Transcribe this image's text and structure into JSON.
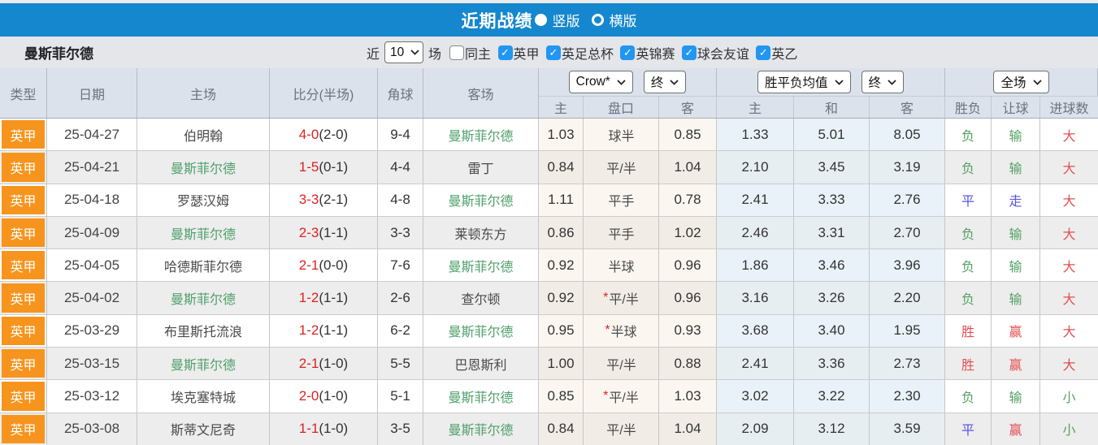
{
  "titlebar": {
    "title": "近期战绩",
    "radios": [
      {
        "label": "竖版",
        "selected": true
      },
      {
        "label": "横版",
        "selected": false
      }
    ]
  },
  "filterbar": {
    "team": "曼斯菲尔德",
    "recent_label": "近",
    "recent_value": "10",
    "matches_label": "场",
    "checkboxes": [
      {
        "label": "同主",
        "checked": false
      },
      {
        "label": "英甲",
        "checked": true
      },
      {
        "label": "英足总杯",
        "checked": true
      },
      {
        "label": "英锦赛",
        "checked": true
      },
      {
        "label": "球会友谊",
        "checked": true
      },
      {
        "label": "英乙",
        "checked": true
      }
    ]
  },
  "table": {
    "static_headers": [
      "类型",
      "日期",
      "主场",
      "比分(半场)",
      "角球",
      "客场"
    ],
    "groups": [
      {
        "selects": [
          "Crow*",
          "终"
        ],
        "cols": [
          "主",
          "盘口",
          "客"
        ]
      },
      {
        "selects": [
          "胜平负均值",
          "终"
        ],
        "cols": [
          "主",
          "和",
          "客"
        ]
      },
      {
        "selects": [
          "全场"
        ],
        "cols": [
          "胜负",
          "让球",
          "进球数"
        ]
      }
    ],
    "rows": [
      {
        "league": "英甲",
        "date": "25-04-27",
        "home": "伯明翰",
        "home_hl": false,
        "score": "4-0",
        "half": "(2-0)",
        "corners": "9-4",
        "away": "曼斯菲尔德",
        "away_hl": true,
        "o_home": "1.03",
        "hcap": "球半",
        "star": false,
        "o_away": "0.85",
        "a_home": "1.33",
        "a_draw": "5.01",
        "a_away": "8.05",
        "res": [
          {
            "t": "负",
            "c": "green"
          },
          {
            "t": "输",
            "c": "green"
          },
          {
            "t": "大",
            "c": "red"
          }
        ]
      },
      {
        "league": "英甲",
        "date": "25-04-21",
        "home": "曼斯菲尔德",
        "home_hl": true,
        "score": "1-5",
        "half": "(0-1)",
        "corners": "4-4",
        "away": "雷丁",
        "away_hl": false,
        "o_home": "0.84",
        "hcap": "平/半",
        "star": false,
        "o_away": "1.04",
        "a_home": "2.10",
        "a_draw": "3.45",
        "a_away": "3.19",
        "res": [
          {
            "t": "负",
            "c": "green"
          },
          {
            "t": "输",
            "c": "green"
          },
          {
            "t": "大",
            "c": "red"
          }
        ]
      },
      {
        "league": "英甲",
        "date": "25-04-18",
        "home": "罗瑟汉姆",
        "home_hl": false,
        "score": "3-3",
        "half": "(2-1)",
        "corners": "4-8",
        "away": "曼斯菲尔德",
        "away_hl": true,
        "o_home": "1.11",
        "hcap": "平手",
        "star": false,
        "o_away": "0.78",
        "a_home": "2.41",
        "a_draw": "3.33",
        "a_away": "2.76",
        "res": [
          {
            "t": "平",
            "c": "blue"
          },
          {
            "t": "走",
            "c": "blue"
          },
          {
            "t": "大",
            "c": "red"
          }
        ]
      },
      {
        "league": "英甲",
        "date": "25-04-09",
        "home": "曼斯菲尔德",
        "home_hl": true,
        "score": "2-3",
        "half": "(1-1)",
        "corners": "3-3",
        "away": "莱顿东方",
        "away_hl": false,
        "o_home": "0.86",
        "hcap": "平手",
        "star": false,
        "o_away": "1.02",
        "a_home": "2.46",
        "a_draw": "3.31",
        "a_away": "2.70",
        "res": [
          {
            "t": "负",
            "c": "green"
          },
          {
            "t": "输",
            "c": "green"
          },
          {
            "t": "大",
            "c": "red"
          }
        ]
      },
      {
        "league": "英甲",
        "date": "25-04-05",
        "home": "哈德斯菲尔德",
        "home_hl": false,
        "score": "2-1",
        "half": "(0-0)",
        "corners": "7-6",
        "away": "曼斯菲尔德",
        "away_hl": true,
        "o_home": "0.92",
        "hcap": "半球",
        "star": false,
        "o_away": "0.96",
        "a_home": "1.86",
        "a_draw": "3.46",
        "a_away": "3.96",
        "res": [
          {
            "t": "负",
            "c": "green"
          },
          {
            "t": "输",
            "c": "green"
          },
          {
            "t": "大",
            "c": "red"
          }
        ]
      },
      {
        "league": "英甲",
        "date": "25-04-02",
        "home": "曼斯菲尔德",
        "home_hl": true,
        "score": "1-2",
        "half": "(1-1)",
        "corners": "2-6",
        "away": "查尔顿",
        "away_hl": false,
        "o_home": "0.92",
        "hcap": "平/半",
        "star": true,
        "o_away": "0.96",
        "a_home": "3.16",
        "a_draw": "3.26",
        "a_away": "2.20",
        "res": [
          {
            "t": "负",
            "c": "green"
          },
          {
            "t": "输",
            "c": "green"
          },
          {
            "t": "大",
            "c": "red"
          }
        ]
      },
      {
        "league": "英甲",
        "date": "25-03-29",
        "home": "布里斯托流浪",
        "home_hl": false,
        "score": "1-2",
        "half": "(1-1)",
        "corners": "6-2",
        "away": "曼斯菲尔德",
        "away_hl": true,
        "o_home": "0.95",
        "hcap": "半球",
        "star": true,
        "o_away": "0.93",
        "a_home": "3.68",
        "a_draw": "3.40",
        "a_away": "1.95",
        "res": [
          {
            "t": "胜",
            "c": "red"
          },
          {
            "t": "赢",
            "c": "red"
          },
          {
            "t": "大",
            "c": "red"
          }
        ]
      },
      {
        "league": "英甲",
        "date": "25-03-15",
        "home": "曼斯菲尔德",
        "home_hl": true,
        "score": "2-1",
        "half": "(1-0)",
        "corners": "5-5",
        "away": "巴恩斯利",
        "away_hl": false,
        "o_home": "1.00",
        "hcap": "平/半",
        "star": false,
        "o_away": "0.88",
        "a_home": "2.41",
        "a_draw": "3.36",
        "a_away": "2.73",
        "res": [
          {
            "t": "胜",
            "c": "red"
          },
          {
            "t": "赢",
            "c": "red"
          },
          {
            "t": "大",
            "c": "red"
          }
        ]
      },
      {
        "league": "英甲",
        "date": "25-03-12",
        "home": "埃克塞特城",
        "home_hl": false,
        "score": "2-0",
        "half": "(1-0)",
        "corners": "5-1",
        "away": "曼斯菲尔德",
        "away_hl": true,
        "o_home": "0.85",
        "hcap": "平/半",
        "star": true,
        "o_away": "1.03",
        "a_home": "3.02",
        "a_draw": "3.22",
        "a_away": "2.30",
        "res": [
          {
            "t": "负",
            "c": "green"
          },
          {
            "t": "输",
            "c": "green"
          },
          {
            "t": "小",
            "c": "green"
          }
        ]
      },
      {
        "league": "英甲",
        "date": "25-03-08",
        "home": "斯蒂文尼奇",
        "home_hl": false,
        "score": "1-1",
        "half": "(1-0)",
        "corners": "3-5",
        "away": "曼斯菲尔德",
        "away_hl": true,
        "o_home": "0.84",
        "hcap": "平/半",
        "star": false,
        "o_away": "1.04",
        "a_home": "2.09",
        "a_draw": "3.12",
        "a_away": "3.59",
        "res": [
          {
            "t": "平",
            "c": "blue"
          },
          {
            "t": "赢",
            "c": "red"
          },
          {
            "t": "小",
            "c": "green"
          }
        ]
      }
    ]
  },
  "colors": {
    "titlebar_blue": "#1587CE",
    "league_orange": "#F7941D",
    "checkbox_blue": "#2196F3",
    "win_red": "#E25050",
    "lose_green": "#55A263",
    "draw_blue": "#5B55DC",
    "team_highlight_green": "#4FA06B",
    "score_red": "#E02222"
  }
}
